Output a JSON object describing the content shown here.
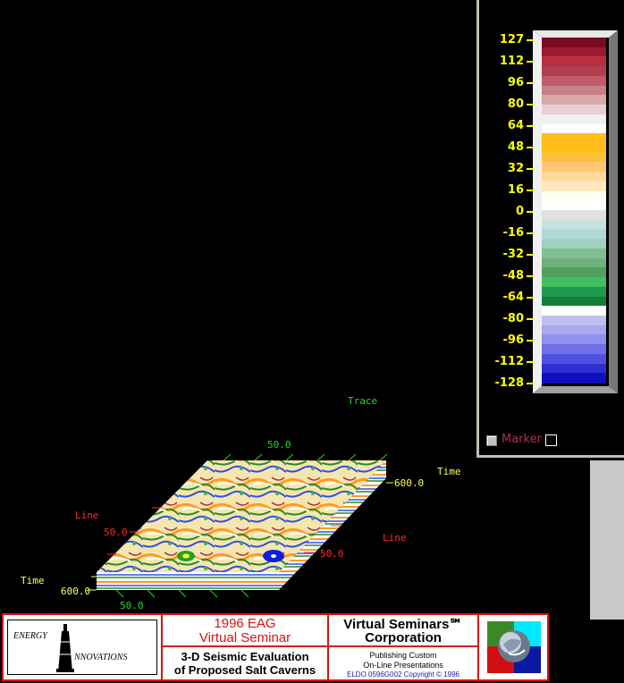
{
  "scene": {
    "trace_title": "Trace",
    "trace_tick": "50.0",
    "time_right_label": "Time",
    "time_right_tick": "600.0",
    "line_left_label": "Line",
    "line_left_tick": "50.0",
    "line_right_label": "Line",
    "line_right_tick": "50.0",
    "time_left_label": "Time",
    "time_left_tick": "600.0",
    "trace_bottom_tick": "50.0"
  },
  "colorbar": {
    "ticks": [
      "127",
      "112",
      "96",
      "80",
      "64",
      "48",
      "32",
      "16",
      "0",
      "-16",
      "-32",
      "-48",
      "-64",
      "-80",
      "-96",
      "-112",
      "-128"
    ],
    "colors": [
      "#7a0a20",
      "#9a1a30",
      "#b83040",
      "#b04050",
      "#c05a6a",
      "#c8808a",
      "#d8a8a8",
      "#e8d0d0",
      "#f0f0f0",
      "#ffffff",
      "#ffbe1a",
      "#ffbe1a",
      "#ffc040",
      "#ffc870",
      "#ffd8a0",
      "#ffe8c0",
      "#fffff0",
      "#ffffff",
      "#e0e0e0",
      "#c8e0e0",
      "#b0d8d8",
      "#a0d0c0",
      "#80c090",
      "#70b080",
      "#50a060",
      "#40c060",
      "#209850",
      "#108038",
      "#ffffff",
      "#c0c0f0",
      "#a8a8f0",
      "#9090f0",
      "#7070e8",
      "#5050e0",
      "#3030d0",
      "#1010c0"
    ]
  },
  "marker": {
    "label": "Marker"
  },
  "footer": {
    "logo_line1": "ENERGY",
    "logo_line2": "NNOVATIONS",
    "eag_line1": "1996 EAG",
    "eag_line2": "Virtual Seminar",
    "seis_line1": "3-D Seismic Evaluation",
    "seis_line2": "of Proposed Salt Caverns",
    "vs_line1": "Virtual Seminars℠",
    "vs_line2": "Corporation",
    "pub_line1": "Publishing Custom",
    "pub_line2": "On-Line Presentations",
    "pub_line3": "ELDO 0596G002 Copyright © 1996"
  }
}
